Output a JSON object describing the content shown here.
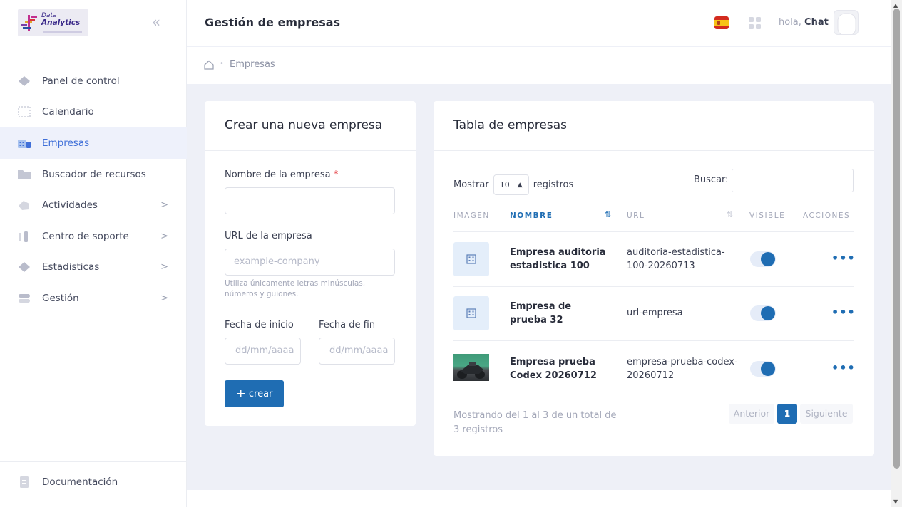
{
  "brand": {
    "line1": "Data",
    "line2": "Analytics"
  },
  "sidebar": {
    "items": [
      {
        "label": "Panel de control",
        "icon": "diamond-icon",
        "chevron": false
      },
      {
        "label": "Calendario",
        "icon": "calendar-icon",
        "chevron": false
      },
      {
        "label": "Empresas",
        "icon": "building-icon",
        "chevron": false,
        "active": true
      },
      {
        "label": "Buscador de recursos",
        "icon": "folder-icon",
        "chevron": false
      },
      {
        "label": "Actividades",
        "icon": "activity-icon",
        "chevron": true
      },
      {
        "label": "Centro de soporte",
        "icon": "support-icon",
        "chevron": true
      },
      {
        "label": "Estadisticas",
        "icon": "stats-icon",
        "chevron": true
      },
      {
        "label": "Gestión",
        "icon": "toggle-icon",
        "chevron": true
      }
    ],
    "chevron_glyph": ">",
    "bottom_item": {
      "label": "Documentación",
      "icon": "document-icon"
    }
  },
  "header": {
    "title": "Gestión de empresas",
    "greeting_prefix": "hola,",
    "user_name": "Chat"
  },
  "breadcrumb": {
    "current": "Empresas"
  },
  "create_form": {
    "title": "Crear una nueva empresa",
    "name_label": "Nombre de la empresa",
    "required_mark": "*",
    "name_value": "",
    "url_label": "URL de la empresa",
    "url_placeholder": "example-company",
    "url_hint": "Utiliza únicamente letras minúsculas, números y guiones.",
    "start_label": "Fecha de inicio",
    "end_label": "Fecha de fin",
    "start_placeholder": "dd/mm/aaaa",
    "end_placeholder": "dd/mm/aaaa",
    "submit_label": "crear",
    "submit_icon": "+"
  },
  "table": {
    "title": "Tabla de empresas",
    "show_label": "Mostrar",
    "show_value": "10",
    "records_label": "registros",
    "search_label": "Buscar:",
    "columns": [
      "Imagen",
      "Nombre",
      "URL",
      "Visible",
      "Acciones"
    ],
    "rows": [
      {
        "name": "Empresa auditoria estadistica 100",
        "url": "auditoria-estadistica-100-20260713",
        "visible": true,
        "image": "building-placeholder"
      },
      {
        "name": "Empresa de prueba 32",
        "url": "url-empresa",
        "visible": true,
        "image": "building-placeholder"
      },
      {
        "name": "Empresa prueba Codex 20260712",
        "url": "empresa-prueba-codex-20260712",
        "visible": true,
        "image": "photo"
      }
    ],
    "actions_glyph": "•••",
    "info": "Mostrando del 1 al 3 de un total de 3 registros",
    "pagination": {
      "prev": "Anterior",
      "current": "1",
      "next": "Siguiente"
    }
  },
  "colors": {
    "accent": "#1f6db3",
    "active_bg": "#eef1fb",
    "page_bg": "#eef0f7"
  }
}
